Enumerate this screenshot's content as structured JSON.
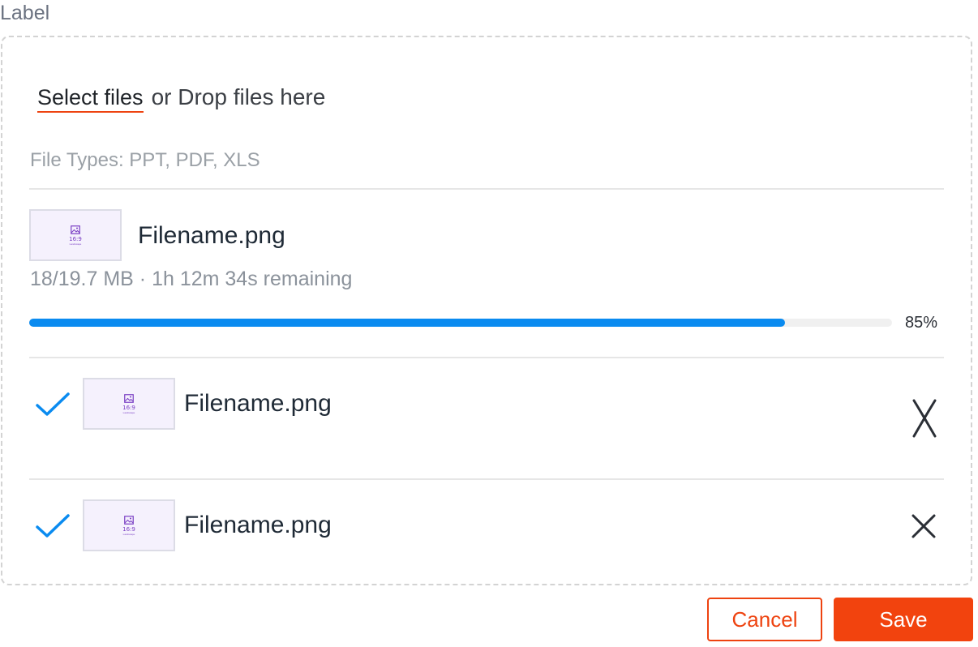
{
  "field": {
    "label": "Label"
  },
  "dropzone": {
    "select_link": "Select files",
    "drop_text": "or Drop files here",
    "file_types": "File Types: PPT, PDF, XLS"
  },
  "uploading": {
    "filename": "Filename.png",
    "thumbnail": {
      "ratio": "16:9",
      "caption": "Landscape",
      "icon": "image-icon"
    },
    "meta": "18/19.7 MB · 1h 12m 34s remaining",
    "progress_value": 0.876,
    "progress_label": "85%",
    "progress_color": "#0a8bf0"
  },
  "uploaded": [
    {
      "filename": "Filename.png",
      "thumbnail": {
        "ratio": "16:9",
        "caption": "Landscape"
      },
      "status_icon": "checkmark-icon",
      "remove_icon": "close-icon"
    },
    {
      "filename": "Filename.png",
      "thumbnail": {
        "ratio": "16:9",
        "caption": "Landscape"
      },
      "status_icon": "checkmark-icon",
      "remove_icon": "close-icon"
    }
  ],
  "actions": {
    "cancel_label": "Cancel",
    "save_label": "Save"
  },
  "colors": {
    "accent": "#f2430e",
    "check": "#0a8bf0",
    "text": "#1f2a36"
  }
}
